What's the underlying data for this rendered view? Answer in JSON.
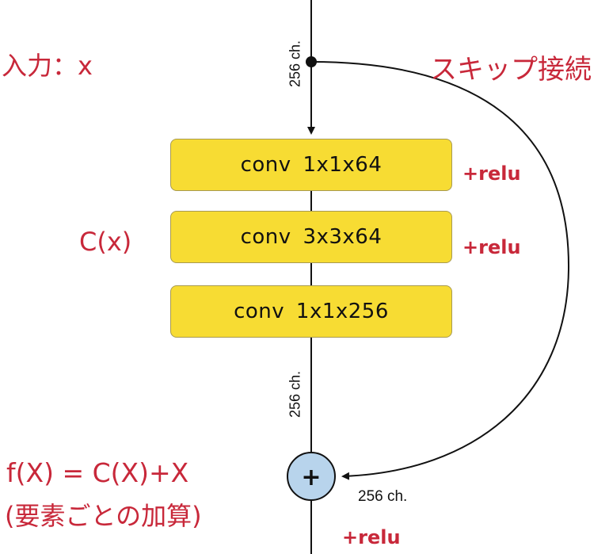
{
  "colors": {
    "box_fill": "#f7dc33",
    "box_border": "#a89a50",
    "annotation": "#c8283a",
    "add_node_fill": "#b8d4ec",
    "line": "#111111"
  },
  "input_label": "入力：x",
  "skip_label": "スキップ接続",
  "cx_label": "C(x)",
  "formula": {
    "line1": "f(X) = C(X)+X",
    "line2": "(要素ごとの加算)"
  },
  "channels": {
    "top": "256 ch.",
    "middle": "256 ch.",
    "skip": "256 ch."
  },
  "blocks": [
    {
      "label": "conv  1x1x64",
      "activation": "+relu"
    },
    {
      "label": "conv  3x3x64",
      "activation": "+relu"
    },
    {
      "label": "conv  1x1x256",
      "activation": ""
    }
  ],
  "add_node": {
    "symbol": "+",
    "icon": "plus-icon"
  },
  "output_activation": "+relu"
}
